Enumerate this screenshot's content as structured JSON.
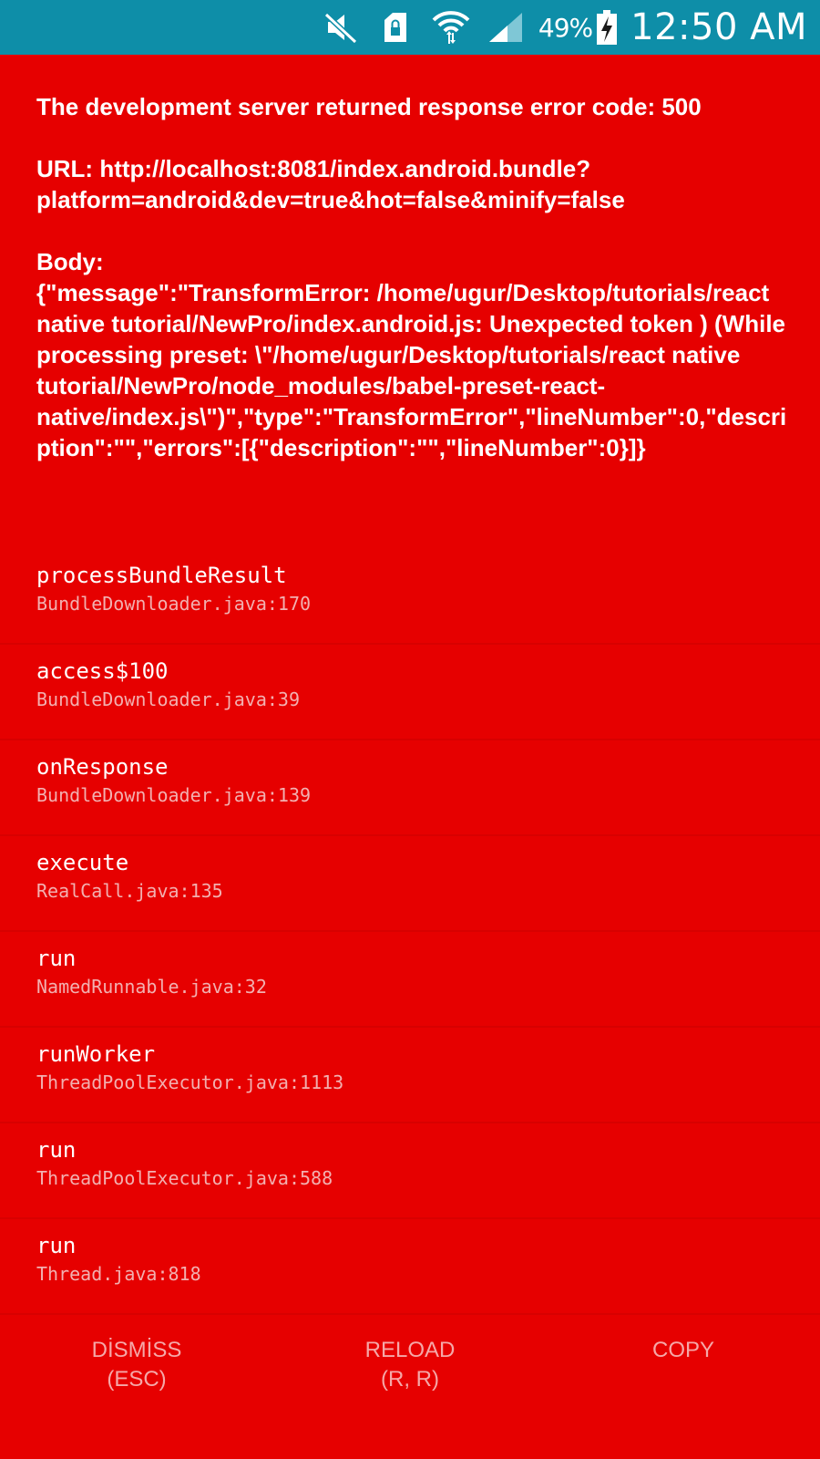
{
  "status_bar": {
    "icons": [
      "mute-icon",
      "lock-sim-icon",
      "wifi-icon",
      "signal-icon",
      "battery-charging-icon"
    ],
    "battery": "49%",
    "time": "12:50 AM",
    "background": "#0e8ea8"
  },
  "error": {
    "background": "#e60000",
    "message": "The development server returned response error code: 500\n\nURL: http://localhost:8081/index.android.bundle?platform=android&dev=true&hot=false&minify=false\n\nBody:\n{\"message\":\"TransformError: /home/ugur/Desktop/tutorials/react native tutorial/NewPro/index.android.js: Unexpected token ) (While processing preset: \\\"/home/ugur/Desktop/tutorials/react native tutorial/NewPro/node_modules/babel-preset-react-native/index.js\\\")\",\"type\":\"TransformError\",\"lineNumber\":0,\"description\":\"\",\"errors\":[{\"description\":\"\",\"lineNumber\":0}]}"
  },
  "stack": [
    {
      "method": "processBundleResult",
      "location": "BundleDownloader.java:170"
    },
    {
      "method": "access$100",
      "location": "BundleDownloader.java:39"
    },
    {
      "method": "onResponse",
      "location": "BundleDownloader.java:139"
    },
    {
      "method": "execute",
      "location": "RealCall.java:135"
    },
    {
      "method": "run",
      "location": "NamedRunnable.java:32"
    },
    {
      "method": "runWorker",
      "location": "ThreadPoolExecutor.java:1113"
    },
    {
      "method": "run",
      "location": "ThreadPoolExecutor.java:588"
    },
    {
      "method": "run",
      "location": "Thread.java:818"
    }
  ],
  "actions": {
    "dismiss": {
      "label": "DİSMİSS",
      "shortcut": "(ESC)"
    },
    "reload": {
      "label": "RELOAD",
      "shortcut": "(R, R)"
    },
    "copy": {
      "label": "COPY",
      "shortcut": ""
    }
  }
}
